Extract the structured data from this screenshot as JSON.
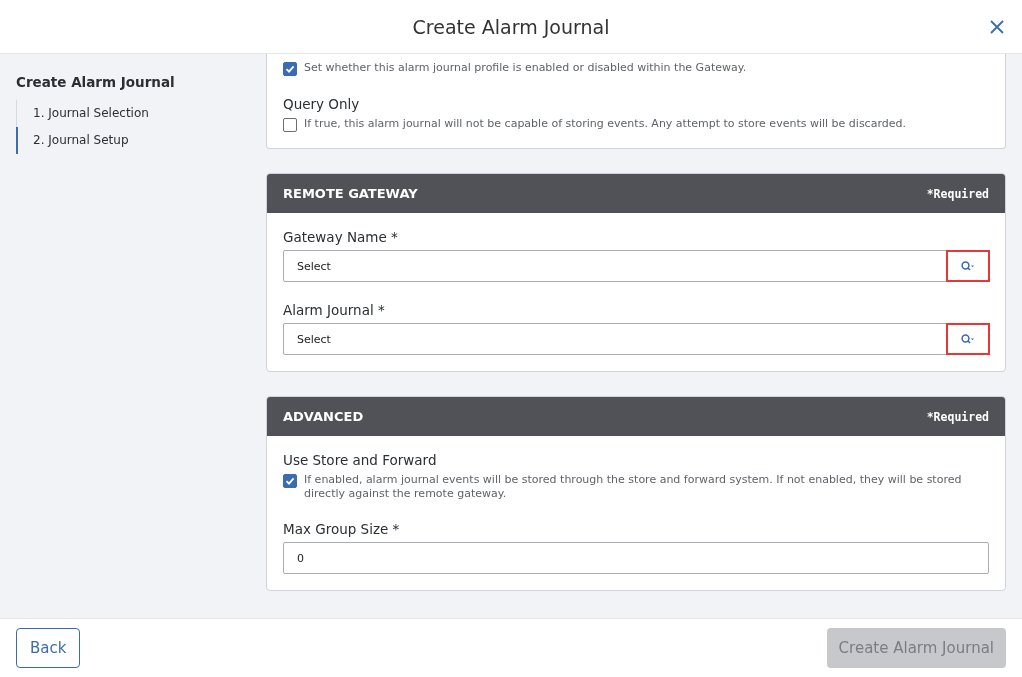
{
  "dialog": {
    "title": "Create Alarm Journal"
  },
  "sidebar": {
    "title": "Create Alarm Journal",
    "steps": [
      {
        "label": "1. Journal Selection",
        "selected": false
      },
      {
        "label": "2. Journal Setup",
        "selected": true
      }
    ]
  },
  "sections": [
    {
      "fields": [
        {
          "kind": "checkbox",
          "description": "Set whether this alarm journal profile is enabled or disabled within the Gateway.",
          "checked": true
        },
        {
          "kind": "checkbox",
          "label": "Query Only",
          "description": "If true, this alarm journal will not be capable of storing events. Any attempt to store events will be discarded.",
          "checked": false
        }
      ]
    },
    {
      "header": {
        "title": "REMOTE GATEWAY",
        "note": "*Required"
      },
      "fields": [
        {
          "kind": "lookup",
          "label": "Gateway Name *",
          "placeholder": "Select",
          "highlighted": true
        },
        {
          "kind": "lookup",
          "label": "Alarm Journal *",
          "placeholder": "Select",
          "highlighted": true
        }
      ]
    },
    {
      "header": {
        "title": "ADVANCED",
        "note": "*Required"
      },
      "fields": [
        {
          "kind": "checkbox",
          "label": "Use Store and Forward",
          "description": "If enabled, alarm journal events will be stored through the store and forward system. If not enabled, they will be stored directly against the remote gateway.",
          "checked": true
        },
        {
          "kind": "number",
          "label": "Max Group Size *",
          "value": "0"
        }
      ]
    }
  ],
  "footer": {
    "back": "Back",
    "submit": {
      "label": "Create Alarm Journal",
      "disabled": true
    }
  }
}
